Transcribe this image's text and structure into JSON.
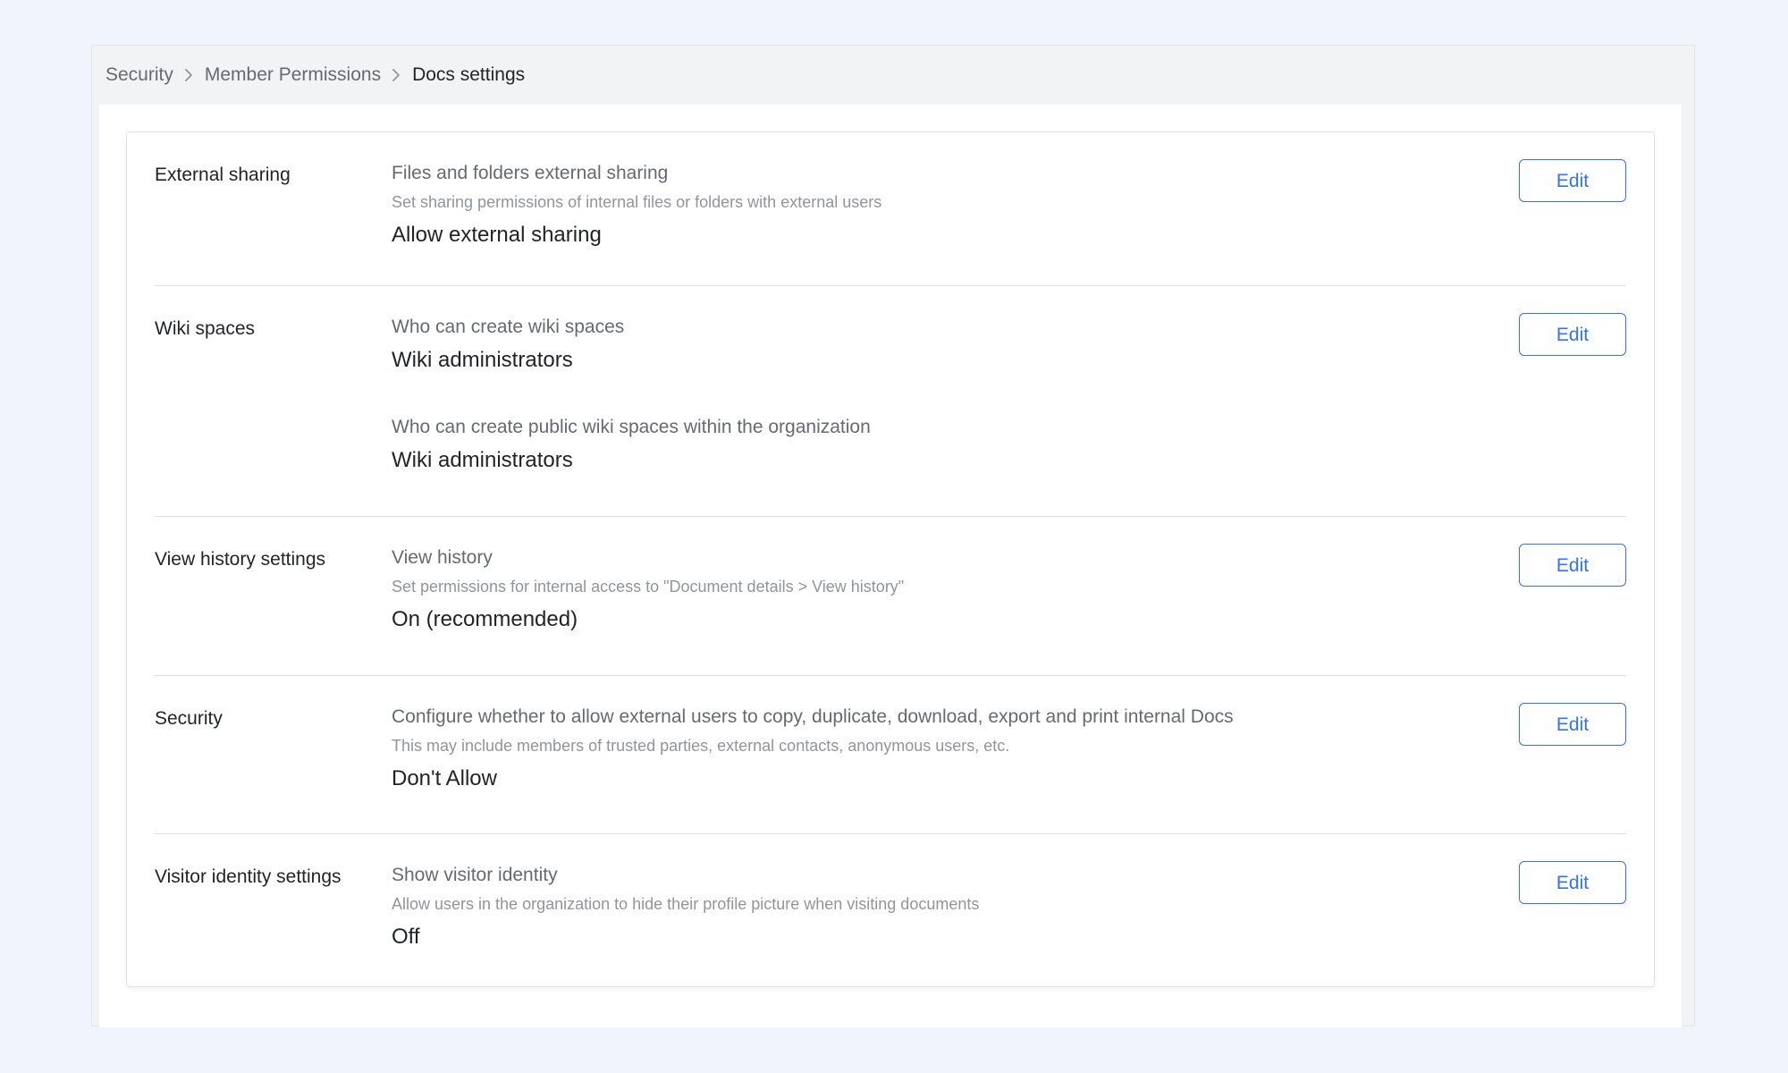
{
  "breadcrumb": [
    {
      "label": "Security"
    },
    {
      "label": "Member Permissions"
    },
    {
      "label": "Docs settings"
    }
  ],
  "sections": [
    {
      "label": "External sharing",
      "edit_label": "Edit",
      "items": [
        {
          "title": "Files and folders external sharing",
          "description": "Set sharing permissions of internal files or folders with external users",
          "value": "Allow external sharing"
        }
      ]
    },
    {
      "label": "Wiki spaces",
      "edit_label": "Edit",
      "items": [
        {
          "title": "Who can create wiki spaces",
          "value": "Wiki administrators"
        },
        {
          "title": "Who can create public wiki spaces within the organization",
          "value": "Wiki administrators"
        }
      ]
    },
    {
      "label": "View history settings",
      "edit_label": "Edit",
      "items": [
        {
          "title": "View history",
          "description": "Set permissions for internal access to \"Document details > View history\"",
          "value": "On (recommended)"
        }
      ]
    },
    {
      "label": "Security",
      "edit_label": "Edit",
      "items": [
        {
          "title": "Configure whether to allow external users to copy, duplicate, download, export and print internal Docs",
          "description": "This may include members of trusted parties, external contacts, anonymous users, etc.",
          "value": "Don't Allow"
        }
      ]
    },
    {
      "label": "Visitor identity settings",
      "edit_label": "Edit",
      "items": [
        {
          "title": "Show visitor identity",
          "description": "Allow users in the organization to hide their profile picture when visiting documents",
          "value": "Off"
        }
      ]
    }
  ],
  "colors": {
    "page_background": "#eff4fd",
    "accent": "#3370ff",
    "text_primary": "#1f2329",
    "text_secondary": "#646a73",
    "text_tertiary": "#8f959e",
    "divider": "#dee0e3"
  }
}
